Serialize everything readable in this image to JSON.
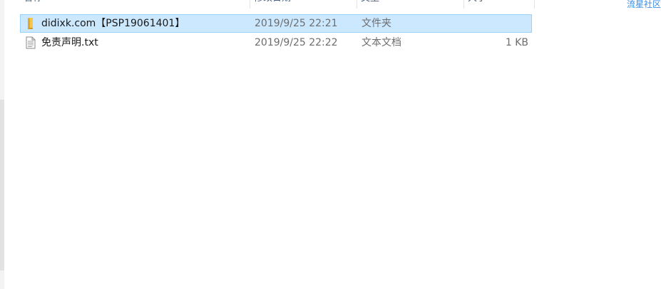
{
  "columns": {
    "name": "名称",
    "date": "修改日期",
    "type": "类型",
    "size": "大小"
  },
  "community_link": "流星社区",
  "files": [
    {
      "name": "didixk.com【PSP19061401】",
      "date": "2019/9/25 22:21",
      "type": "文件夹",
      "size": "",
      "icon": "folder-icon",
      "selected": true
    },
    {
      "name": "免责声明.txt",
      "date": "2019/9/25 22:22",
      "type": "文本文档",
      "size": "1 KB",
      "icon": "text-file-icon",
      "selected": false
    }
  ],
  "colors": {
    "selection_bg": "#cce8ff",
    "selection_border": "#99d1ff",
    "folder": "#f3c74f",
    "link": "#3b8de6"
  }
}
